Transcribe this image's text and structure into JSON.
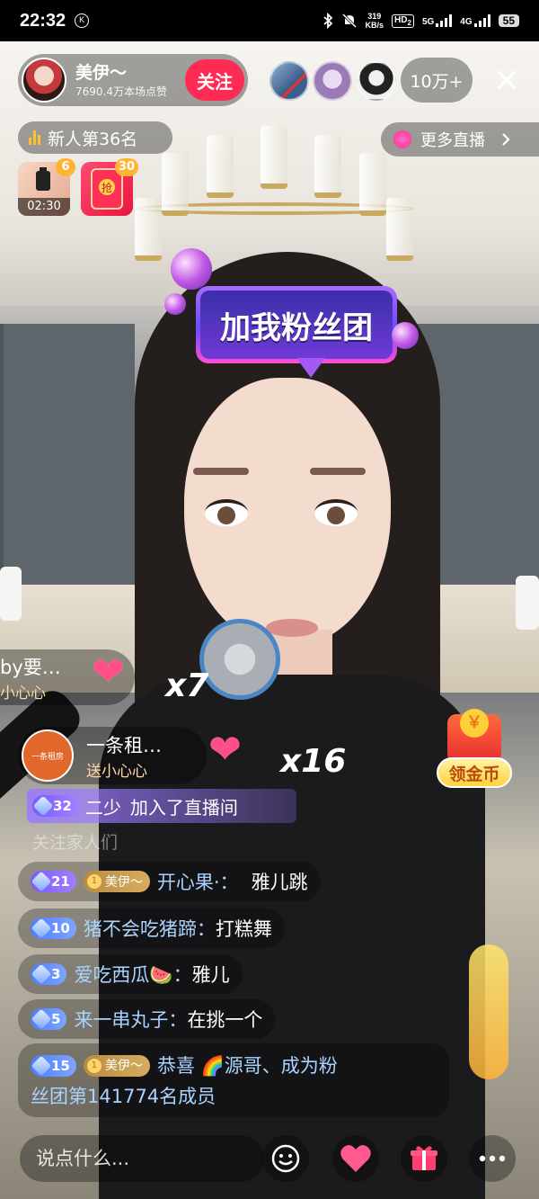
{
  "status_bar": {
    "time": "22:32",
    "k_badge": "K",
    "net_speed_value": "319",
    "net_speed_unit": "KB/s",
    "hd": "HD",
    "hd_sub": "2",
    "network_5g": "5G",
    "network_4g": "4G",
    "battery": "55",
    "icons": [
      "bluetooth-icon",
      "mute-bell-icon",
      "signal-icon",
      "battery-icon"
    ]
  },
  "header": {
    "anchor_name": "美伊～",
    "anchor_likes": "7690.4万本场点赞",
    "follow_label": "关注",
    "viewer_count": "10万+",
    "close_icon": "close-icon"
  },
  "rank": {
    "label": "新人第36名"
  },
  "more_live": {
    "label": "更多直播"
  },
  "gift_boxes": [
    {
      "badge": "6",
      "timer": "02:30"
    },
    {
      "badge": "30",
      "glyph": "抢"
    }
  ],
  "sticker": {
    "text": "加我粉丝团"
  },
  "gift_notices": [
    {
      "title": "by要…",
      "sub": "小心心",
      "combo": "x7"
    },
    {
      "title": "一条租…",
      "sub": "送小心心",
      "combo": "x16",
      "logo_text": "一条租房"
    }
  ],
  "enter_message": {
    "level": "32",
    "user": "二少",
    "text": "加入了直播间"
  },
  "faded_line": "关注家人们",
  "chat": [
    {
      "level": "21",
      "fan_badge": "美伊～",
      "user": "开心果·：",
      "text": "雅儿跳"
    },
    {
      "level": "10",
      "user": "猪不会吃猪蹄：",
      "text": "打糕舞"
    },
    {
      "level": "3",
      "user": "爱吃西瓜🍉：",
      "text": "雅儿"
    },
    {
      "level": "5",
      "user": "来一串丸子：",
      "text": "在挑一个"
    }
  ],
  "chat_big": {
    "level": "15",
    "fan_badge": "美伊～",
    "line1": "恭喜 🌈源哥、成为粉",
    "line2": "丝团第141774名成员"
  },
  "coin_widget": {
    "label": "领金币"
  },
  "bottom_bar": {
    "comment_placeholder": "说点什么...",
    "icons": [
      "emoji-icon",
      "heart-icon",
      "gift-icon",
      "more-icon"
    ]
  },
  "colors": {
    "follow": "#fe2c55",
    "username": "#a8d3ff",
    "rank_bars": "#ffc12e",
    "fan_badge": "#c99b48"
  }
}
